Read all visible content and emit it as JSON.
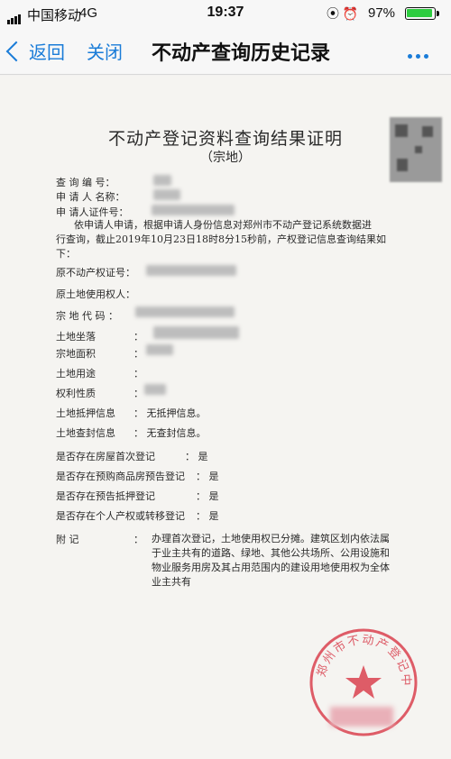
{
  "status_bar": {
    "carrier": "中国移动",
    "network": "4G",
    "time": "19:37",
    "battery_percent": "97%",
    "battery_level": 0.97,
    "battery_color": "#2ecc40"
  },
  "nav": {
    "back_label": "返回",
    "close_label": "关闭",
    "title": "不动产查询历史记录",
    "more_icon": "more-dots-icon",
    "accent_color": "#1a7cd8"
  },
  "document": {
    "title": "不动产登记资料查询结果证明",
    "subtitle": "（宗地）",
    "header_fields": {
      "query_no": "查 询 编 号：",
      "applicant_name": "申 请 人 名称：",
      "applicant_id": "申 请人证件号："
    },
    "intro_lines": [
      "依申请人申请，根据申请人身份信息对郑州市不动产登记系统数据进",
      "行查询，截止2019年10月23日18时8分15秒前，产权登记信息查询结果如",
      "下："
    ],
    "fields": [
      {
        "label": "原不动产权证号：",
        "value": ""
      },
      {
        "label": "原土地使用权人：",
        "value": ""
      },
      {
        "label": "宗 地 代 码 ：",
        "value": ""
      },
      {
        "label": "土地坐落",
        "value": "："
      },
      {
        "label": "宗地面积",
        "value": "："
      },
      {
        "label": "土地用途",
        "value": "："
      },
      {
        "label": "权利性质",
        "value": "："
      }
    ],
    "mortgage": {
      "label": "土地抵押信息",
      "value": "：  无抵押信息。"
    },
    "seizure": {
      "label": "土地查封信息",
      "value": "：  无查封信息。"
    },
    "yes_no": [
      {
        "label": "是否存在房屋首次登记",
        "value": "：  是"
      },
      {
        "label": "是否存在预购商品房预告登记",
        "value": "：  是"
      },
      {
        "label": "是否存在预告抵押登记",
        "value": "：  是"
      },
      {
        "label": "是否存在个人产权或转移登记",
        "value": "：  是"
      }
    ],
    "remark_label": "附        记",
    "remark_colon": "：",
    "remark_lines": [
      "办理首次登记，土地使用权已分摊。建筑区划内依法属",
      "于业主共有的道路、绿地、其他公共场所、公用设施和",
      "物业服务用房及其占用范围内的建设用地使用权为全体",
      "业主共有"
    ],
    "stamp_text": "郑州市不动产登记中心",
    "stamp_color": "#d9414f"
  }
}
